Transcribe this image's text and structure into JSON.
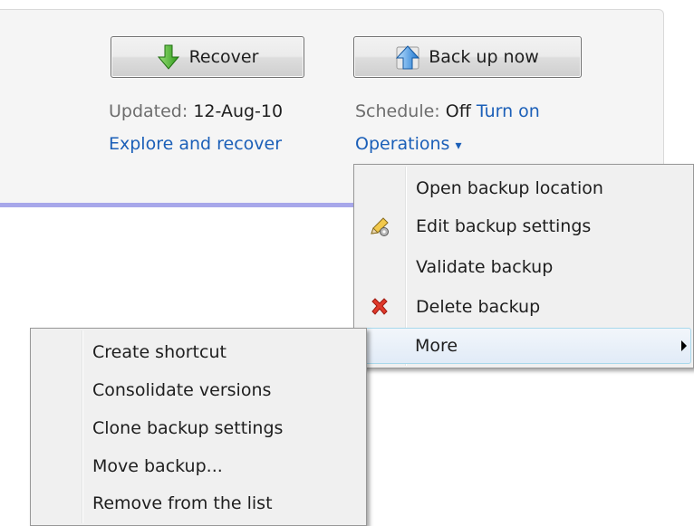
{
  "panel": {
    "recover_button": {
      "label": "Recover",
      "icon": "green-down-arrow-icon"
    },
    "backup_button": {
      "label": "Back up now",
      "icon": "blue-up-arrow-icon"
    },
    "updated_label": "Updated:",
    "updated_value": "12-Aug-10",
    "explore_link": "Explore and recover",
    "schedule_label": "Schedule:",
    "schedule_value": "Off",
    "turn_on_link": "Turn on",
    "operations_link": "Operations",
    "operations_arrow": "▾"
  },
  "operations_menu": {
    "items": [
      {
        "label": "Open backup location",
        "icon": ""
      },
      {
        "label": "Edit backup settings",
        "icon": "pencil-gear-icon"
      },
      {
        "label": "Validate backup",
        "icon": ""
      },
      {
        "label": "Delete backup",
        "icon": "red-x-icon"
      },
      {
        "label": "More",
        "icon": "",
        "has_submenu": true,
        "hovered": true
      }
    ]
  },
  "more_submenu": {
    "items": [
      {
        "label": "Create shortcut"
      },
      {
        "label": "Consolidate versions"
      },
      {
        "label": "Clone backup settings"
      },
      {
        "label": "Move backup..."
      },
      {
        "label": "Remove from the list"
      }
    ]
  },
  "colors": {
    "link": "#1b5fb8",
    "muted_text": "#6d6d6d",
    "accent_bar": "#a7a7ea",
    "menu_bg": "#f0f0f0",
    "hover_border": "#a8d8eb"
  }
}
